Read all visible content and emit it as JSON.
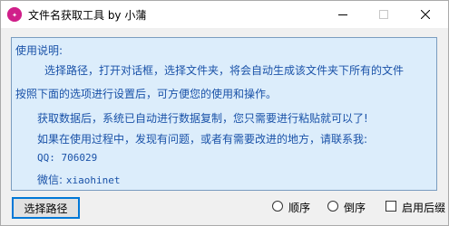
{
  "window": {
    "title": "文件名获取工具 by 小蒲"
  },
  "info": {
    "heading": "使用说明:",
    "paragraph_line_1": "选择路径，打开对话框，选择文件夹，将会自动生成该文件夹下所有的文件",
    "paragraph_line_2": "按照下面的选项进行设置后，可方便您的使用和操作。",
    "line_copy": "获取数据后，系统已自动进行数据复制，您只需要进行粘贴就可以了!",
    "line_contact": "如果在使用过程中，发现有问题，或者有需要改进的地方，请联系我:",
    "line_qq": "QQ: 706029",
    "wechat_label": "微信:",
    "wechat_value": "xiaohinet"
  },
  "controls": {
    "select_path_label": "选择路径",
    "ascending_label": "顺序",
    "descending_label": "倒序",
    "enable_suffix_label": "启用后缀",
    "ascending_selected": false,
    "descending_selected": false,
    "enable_suffix_checked": false
  },
  "colors": {
    "panel_background": "#dcedfb",
    "panel_text": "#1a52a8",
    "app_icon": "#d0208a"
  },
  "icons": {
    "app": "app-logo-icon",
    "minimize": "minimize-icon",
    "maximize": "maximize-icon",
    "close": "close-icon"
  }
}
